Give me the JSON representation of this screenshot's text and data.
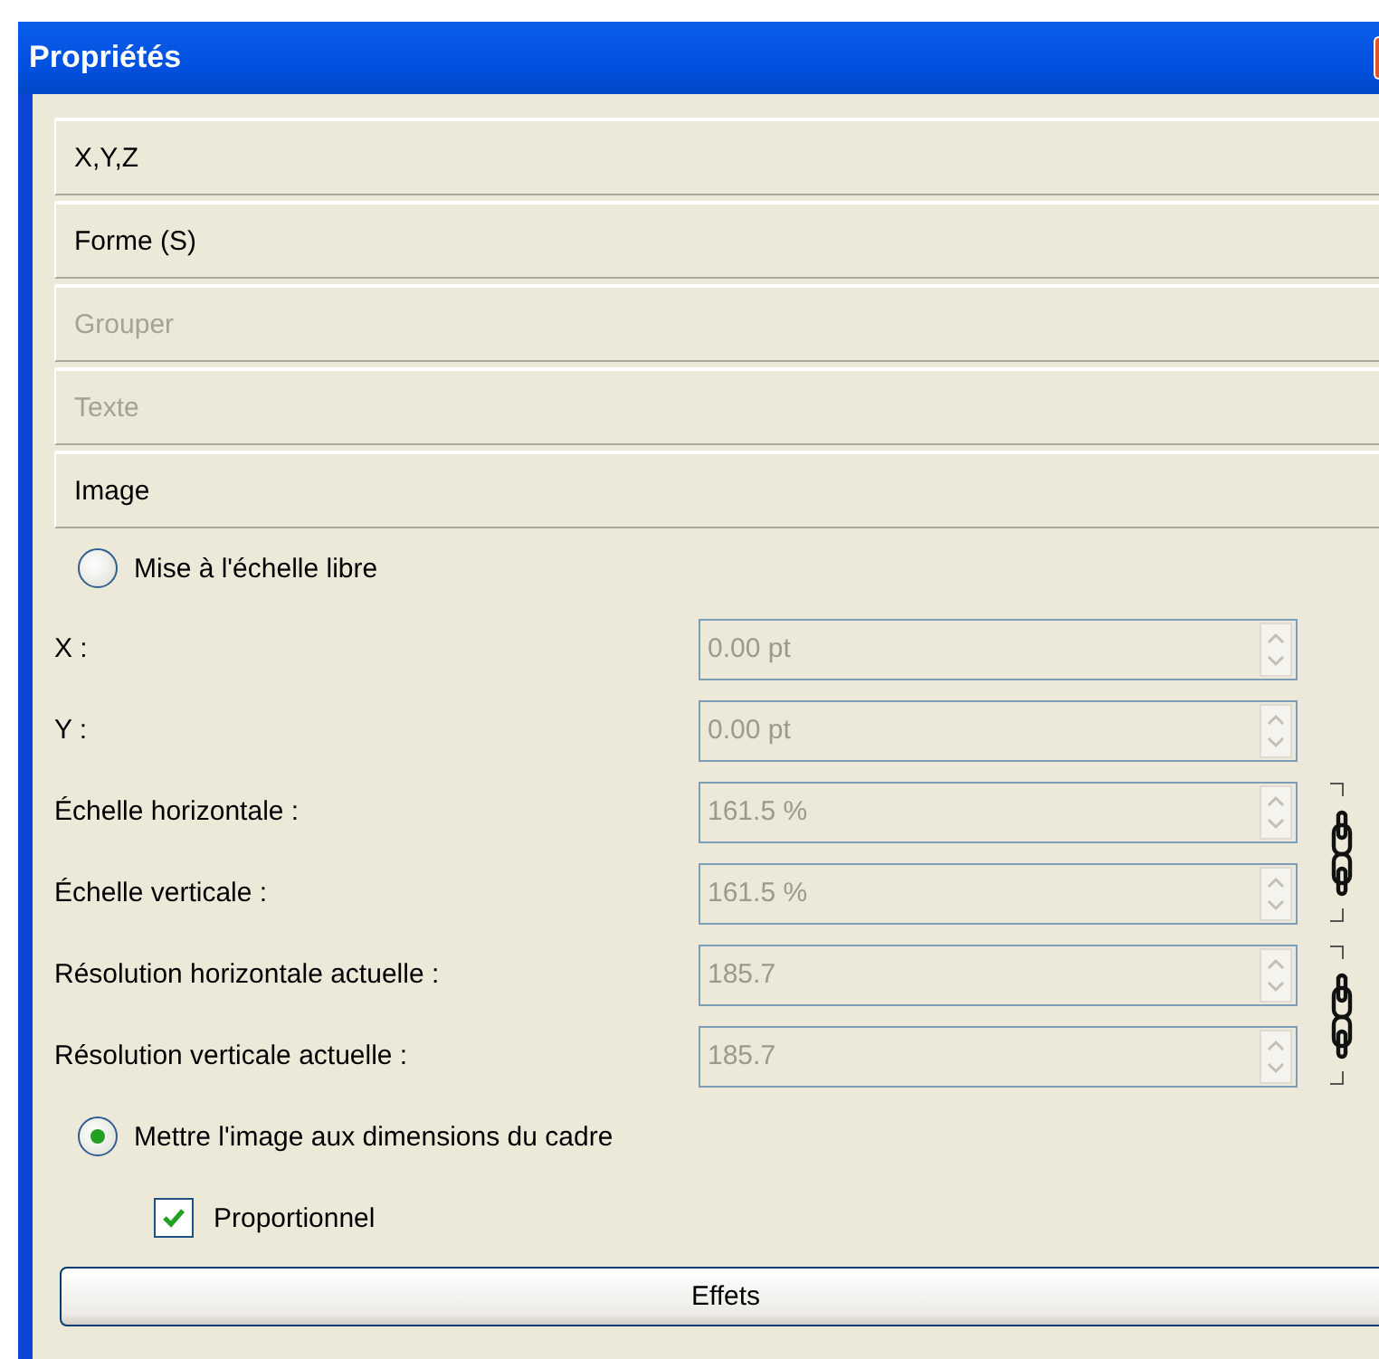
{
  "window": {
    "title": "Propriétés"
  },
  "sections": [
    {
      "label": "X,Y,Z",
      "disabled": false
    },
    {
      "label": "Forme (S)",
      "disabled": false
    },
    {
      "label": "Grouper",
      "disabled": true
    },
    {
      "label": "Texte",
      "disabled": true
    },
    {
      "label": "Image",
      "disabled": false
    }
  ],
  "scale_modes": [
    {
      "label": "Mise à l'échelle libre",
      "selected": false
    },
    {
      "label": "Mettre l'image aux dimensions du cadre",
      "selected": true
    }
  ],
  "fields": [
    {
      "label": "X :",
      "value": "0.00 pt",
      "disabled": true,
      "linked": false
    },
    {
      "label": "Y :",
      "value": "0.00 pt",
      "disabled": true,
      "linked": false
    },
    {
      "label": "Échelle horizontale :",
      "value": "161.5 %",
      "disabled": true,
      "linked": true
    },
    {
      "label": "Échelle verticale :",
      "value": "161.5 %",
      "disabled": true,
      "linked": true
    },
    {
      "label": "Résolution horizontale actuelle :",
      "value": "185.7",
      "disabled": true,
      "linked": true
    },
    {
      "label": "Résolution verticale actuelle :",
      "value": "185.7",
      "disabled": true,
      "linked": true
    }
  ],
  "proportional": {
    "label": "Proportionnel",
    "checked": true
  },
  "button": {
    "label": "Effets"
  }
}
